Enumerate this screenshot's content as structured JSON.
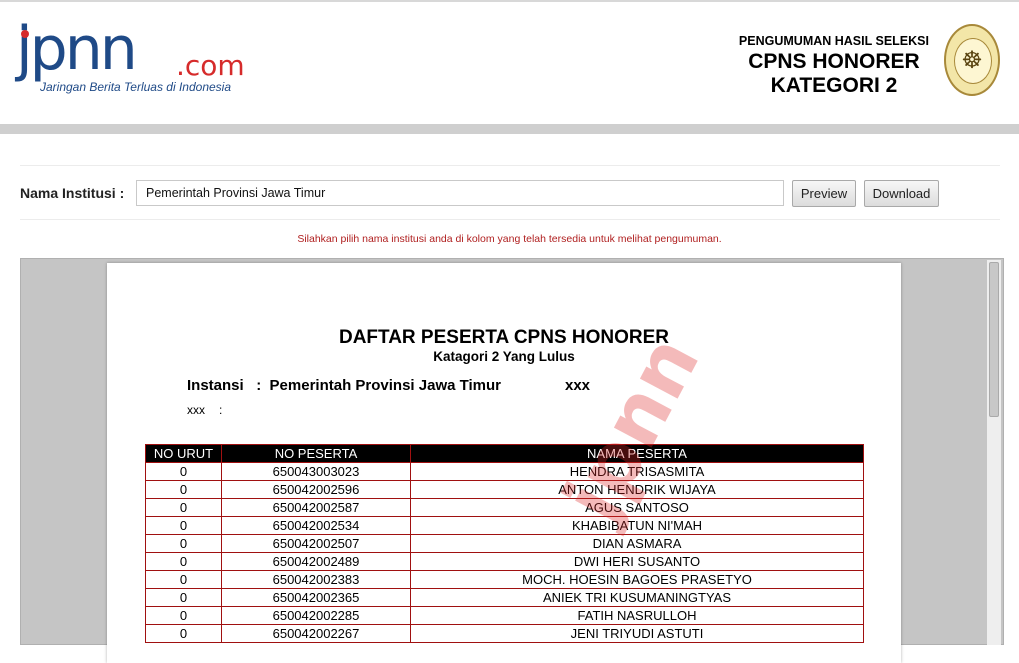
{
  "header": {
    "brand": {
      "name": "jpnn",
      "domain": ".com",
      "tagline": "Jaringan Berita Terluas di Indonesia"
    },
    "announcement": {
      "line1": "PENGUMUMAN HASIL SELEKSI",
      "line2": "CPNS HONORER",
      "line3": "KATEGORI 2"
    },
    "seal_icon": "government-seal-icon"
  },
  "form": {
    "label": "Nama Institusi",
    "separator": ":",
    "value": "Pemerintah Provinsi Jawa Timur",
    "preview_label": "Preview",
    "download_label": "Download",
    "hint": "Silahkan pilih nama institusi anda di kolom yang telah tersedia untuk melihat pengumuman."
  },
  "document": {
    "title": "DAFTAR PESERTA CPNS HONORER",
    "subtitle": "Katagori 2 Yang Lulus",
    "instansi_label": "Instansi",
    "instansi_sep": ":",
    "instansi_value": "Pemerintah Provinsi Jawa Timur",
    "instansi_code": "xxx",
    "sub_label": "xxx",
    "sub_sep": ":",
    "watermark": "jpnn",
    "table": {
      "headers": [
        "NO URUT",
        "NO PESERTA",
        "NAMA PESERTA"
      ],
      "rows": [
        [
          "0",
          "650043003023",
          "HENDRA TRISASMITA"
        ],
        [
          "0",
          "650042002596",
          "ANTON HENDRIK WIJAYA"
        ],
        [
          "0",
          "650042002587",
          "AGUS SANTOSO"
        ],
        [
          "0",
          "650042002534",
          "KHABIBATUN NI'MAH"
        ],
        [
          "0",
          "650042002507",
          "DIAN ASMARA"
        ],
        [
          "0",
          "650042002489",
          "DWI HERI SUSANTO"
        ],
        [
          "0",
          "650042002383",
          "MOCH. HOESIN BAGOES PRASETYO"
        ],
        [
          "0",
          "650042002365",
          "ANIEK TRI KUSUMANINGTYAS"
        ],
        [
          "0",
          "650042002285",
          "FATIH NASRULLOH"
        ],
        [
          "0",
          "650042002267",
          "JENI TRIYUDI ASTUTI"
        ]
      ]
    }
  }
}
